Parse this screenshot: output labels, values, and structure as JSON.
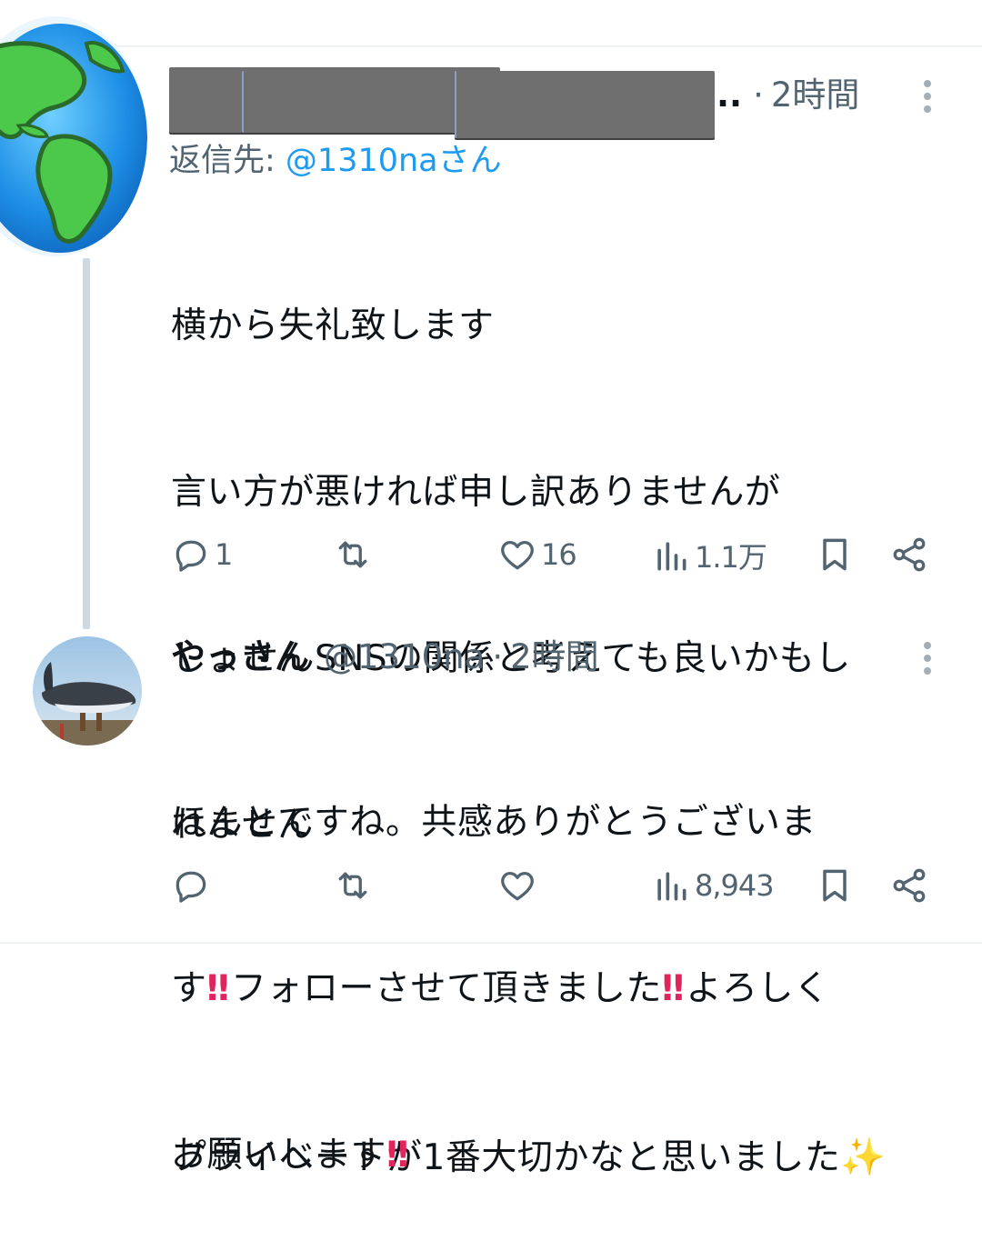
{
  "tweet1": {
    "time": "2時間",
    "reply_to_prefix": "返信先: ",
    "reply_to_handle": "@1310naさん",
    "body_lines": [
      "横から失礼致します",
      "言い方が悪ければ申し訳ありませんが",
      "しょせんSNSの関係と考えても良いかもし",
      "れません",
      "",
      "プライベートが1番大切かなと思いました"
    ],
    "emoji_end": "✨",
    "ellipsis": "..",
    "separator": "·",
    "stats": {
      "replies": "1",
      "retweets": "",
      "likes": "16",
      "views": "1.1万"
    }
  },
  "tweet2": {
    "display_name": "やっさん",
    "handle": "@1310na",
    "separator": "·",
    "time": "2時間",
    "line1": "ほんとですね。共感ありがとうございま",
    "line2_a": "す",
    "line2_b": "フォローさせて頂きました",
    "line2_c": "よろしく",
    "line3": "お願いします",
    "emoji_bang": "‼",
    "stats": {
      "replies": "",
      "retweets": "",
      "likes": "",
      "views": "8,943"
    }
  },
  "colors": {
    "accent": "#1d9bf0",
    "muted": "#536471",
    "divider": "#eff3f4",
    "thread_line": "#cfd9de"
  },
  "icons": [
    "reply-icon",
    "retweet-icon",
    "like-icon",
    "views-icon",
    "bookmark-icon",
    "share-icon",
    "more-icon"
  ]
}
